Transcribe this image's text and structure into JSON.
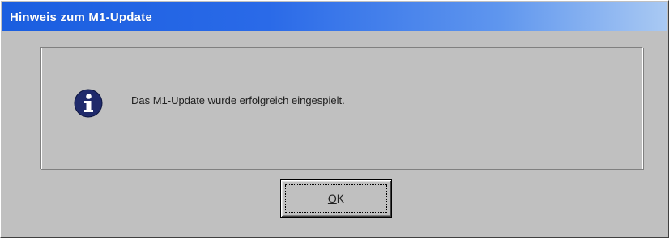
{
  "dialog": {
    "title": "Hinweis zum M1-Update",
    "message": "Das M1-Update wurde erfolgreich eingespielt.",
    "icon": "info-icon",
    "ok_button": {
      "accel": "O",
      "rest": "K"
    }
  },
  "colors": {
    "titlebar_start": "#1a5ee0",
    "titlebar_end": "#a9c9f3",
    "face": "#c0c0c0",
    "icon_fill": "#1f2a6b"
  }
}
